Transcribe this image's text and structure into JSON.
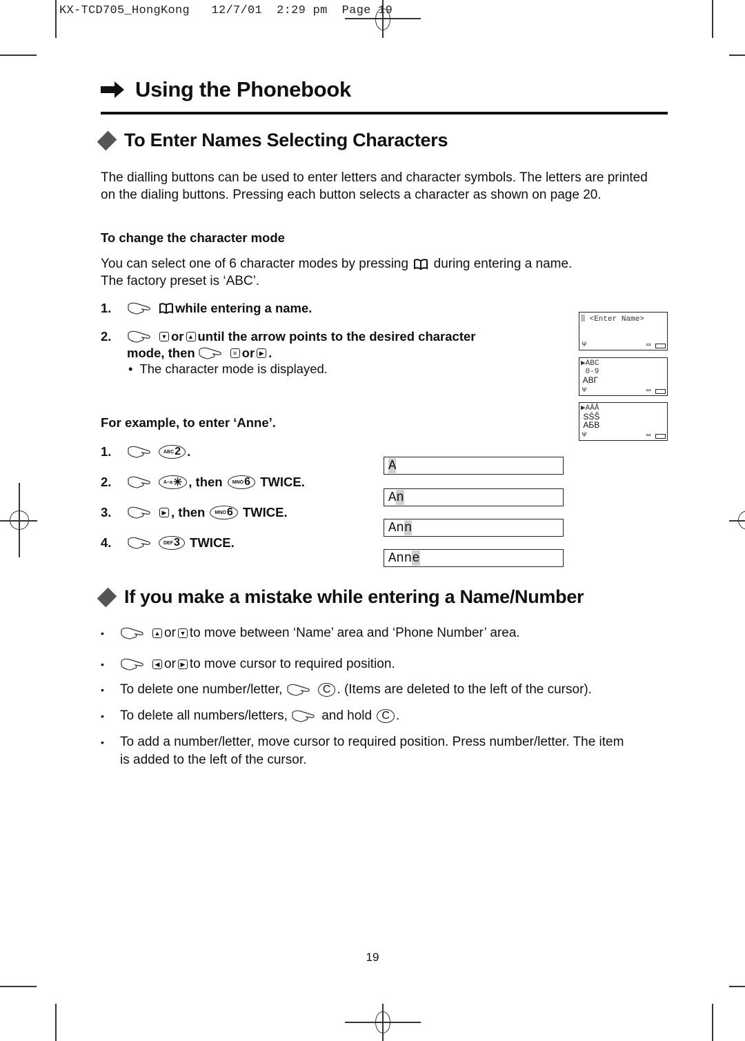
{
  "slug": {
    "doc_id": "KX-TCD705_HongKong",
    "date": "12/7/01",
    "time": "2:29 pm",
    "page_label": "Page 19"
  },
  "page_title": "Using the Phonebook",
  "section1": {
    "title": "To Enter Names Selecting Characters",
    "intro": "The dialling buttons can be used to enter letters and character symbols. The letters are printed on the dialing buttons. Pressing each button selects a character as shown on page 20.",
    "subheading": "To change the character mode",
    "mode_text_before": "You can select one of 6 character modes by pressing",
    "mode_text_after": "during entering a name.",
    "factory_preset": "The factory preset is ‘ABC’.",
    "steps": [
      {
        "num": "1.",
        "text": "while entering a name."
      },
      {
        "num": "2.",
        "or": "or",
        "text": "until the arrow points to the desired character",
        "line2": "mode, then",
        "or2": "or",
        "end": ".",
        "note": "The character mode is displayed."
      }
    ],
    "lcd_screens": [
      {
        "rows": [
          "<Enter Name>"
        ],
        "has_cursor": true
      },
      {
        "rows": [
          "▶ABC",
          " 0-9",
          " ΑΒΓ"
        ]
      },
      {
        "rows": [
          "▶AĂÅ",
          " SŚŠ",
          " АБВ"
        ]
      }
    ],
    "example_heading": "For example, to enter ‘Anne’.",
    "example_steps": [
      {
        "num": "1.",
        "key1": {
          "small": "ABC",
          "big": "2"
        },
        "text": "."
      },
      {
        "num": "2.",
        "key1": {
          "small": "A–a",
          "big": "✳"
        },
        "then": ", then",
        "key2": {
          "small": "MNO",
          "big": "6"
        },
        "text": "TWICE."
      },
      {
        "num": "3.",
        "then": ", then",
        "key2": {
          "small": "MNO",
          "big": "6"
        },
        "text": "TWICE."
      },
      {
        "num": "4.",
        "key1": {
          "small": "DEF",
          "big": "3"
        },
        "text": "TWICE."
      }
    ],
    "name_displays": [
      {
        "typed": "",
        "cursor": "A"
      },
      {
        "typed": "A",
        "cursor": "n"
      },
      {
        "typed": "An",
        "cursor": "n"
      },
      {
        "typed": "Ann",
        "cursor": "e"
      }
    ]
  },
  "section2": {
    "title": "If you make a mistake while entering a Name/Number",
    "bullets": [
      {
        "or": "or",
        "text": "to move between ‘Name’ area and ‘Phone Number’ area."
      },
      {
        "or": "or",
        "text": "to move cursor to required position."
      },
      {
        "before": "To delete one number/letter,",
        "key": "C",
        "after": ". (Items are deleted to the left of the cursor)."
      },
      {
        "before": "To delete all numbers/letters,",
        "middle": "and hold",
        "key": "C",
        "after": "."
      },
      {
        "line1": "To add a number/letter, move cursor to required position. Press number/letter. The item",
        "line2": "is added to the left of the cursor."
      }
    ]
  },
  "page_number": "19"
}
